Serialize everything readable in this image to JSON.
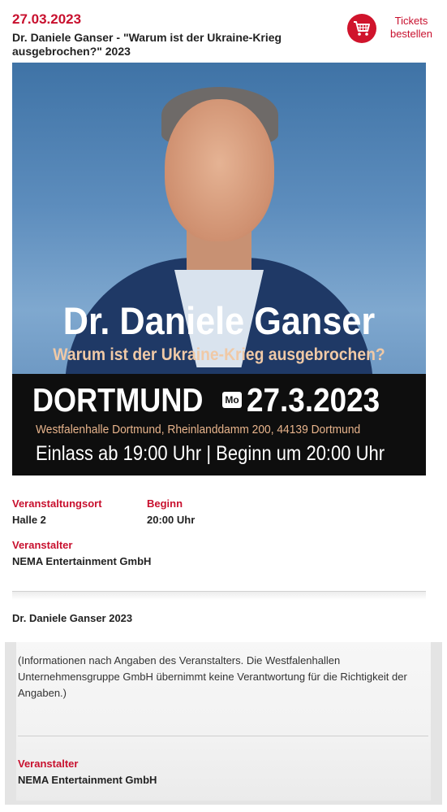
{
  "event": {
    "date": "27.03.2023",
    "title": "Dr. Daniele Ganser - \"Warum ist der Ukraine-Krieg ausgebrochen?\" 2023",
    "tickets_label": "Tickets bestellen",
    "tickets_icon": "cart-icon",
    "accent_color": "#c8102e"
  },
  "poster": {
    "name": "Dr. Daniele Ganser",
    "subtitle": "Warum ist der Ukraine-Krieg ausgebrochen?",
    "city": "DORTMUND",
    "weekday": "Mo",
    "date": "27.3.2023",
    "venue": "Westfalenhalle Dortmund, Rheinlanddamm 200, 44139 Dortmund",
    "times": "Einlass ab 19:00 Uhr | Beginn um 20:00 Uhr"
  },
  "details": {
    "venue_label": "Veranstaltungsort",
    "venue_value": "Halle 2",
    "start_label": "Beginn",
    "start_value": "20:00 Uhr",
    "organizer_label": "Veranstalter",
    "organizer_value": "NEMA Entertainment GmbH"
  },
  "event_name": "Dr. Daniele Ganser 2023",
  "info": {
    "disclaimer": "(Informationen nach Angaben des Veranstalters. Die Westfalenhallen Unternehmensgruppe GmbH übernimmt keine Verantwortung für die Richtigkeit der Angaben.)",
    "organizer_label": "Veranstalter",
    "organizer_value": "NEMA Entertainment GmbH"
  }
}
